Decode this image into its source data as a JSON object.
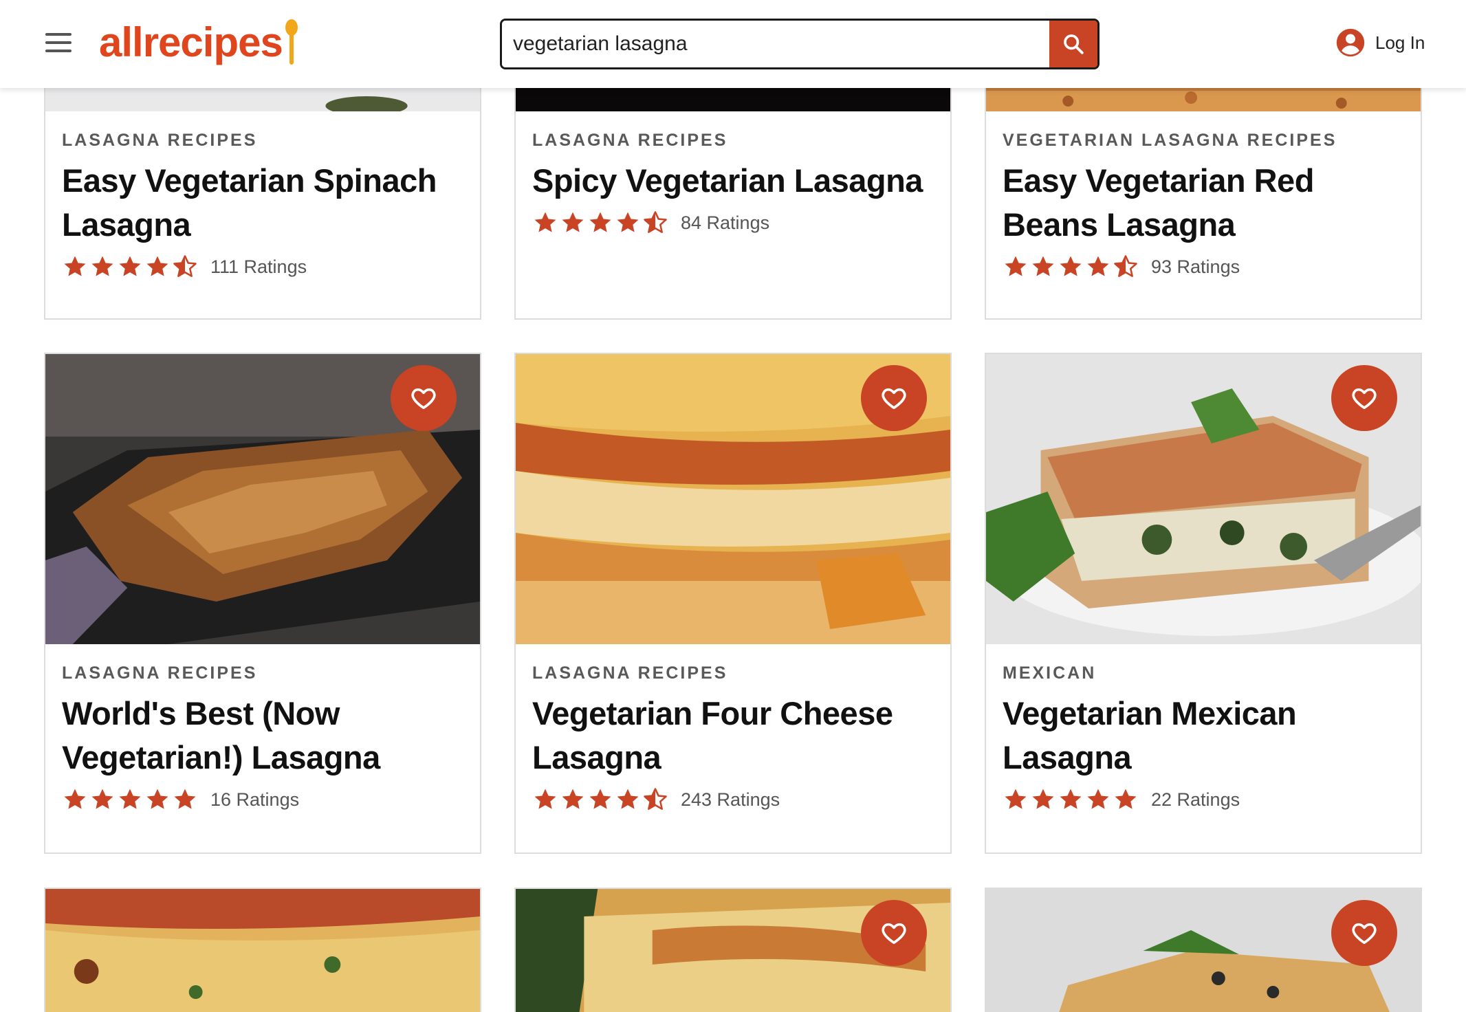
{
  "header": {
    "logo_text": "allrecipes",
    "search_value": "vegetarian lasagna",
    "login_label": "Log In",
    "accent_color": "#c94424"
  },
  "cards": [
    {
      "tag": "LASAGNA RECIPES",
      "title": "Easy Vegetarian Spinach Lasagna",
      "rating": 4.5,
      "ratings_label": "111 Ratings"
    },
    {
      "tag": "LASAGNA RECIPES",
      "title": "Spicy Vegetarian Lasagna",
      "rating": 4.5,
      "ratings_label": "84 Ratings"
    },
    {
      "tag": "VEGETARIAN LASAGNA RECIPES",
      "title": "Easy Vegetarian Red Beans Lasagna",
      "rating": 4.5,
      "ratings_label": "93 Ratings"
    },
    {
      "tag": "LASAGNA RECIPES",
      "title": "World's Best (Now Vegetarian!) Lasagna",
      "rating": 5,
      "ratings_label": "16 Ratings"
    },
    {
      "tag": "LASAGNA RECIPES",
      "title": "Vegetarian Four Cheese Lasagna",
      "rating": 4.5,
      "ratings_label": "243 Ratings"
    },
    {
      "tag": "MEXICAN",
      "title": "Vegetarian Mexican Lasagna",
      "rating": 5,
      "ratings_label": "22 Ratings"
    }
  ],
  "icons": {
    "menu": "hamburger-menu-icon",
    "search": "search-icon",
    "account": "user-circle-icon",
    "favorite": "heart-outline-icon",
    "star": "star-icon"
  }
}
